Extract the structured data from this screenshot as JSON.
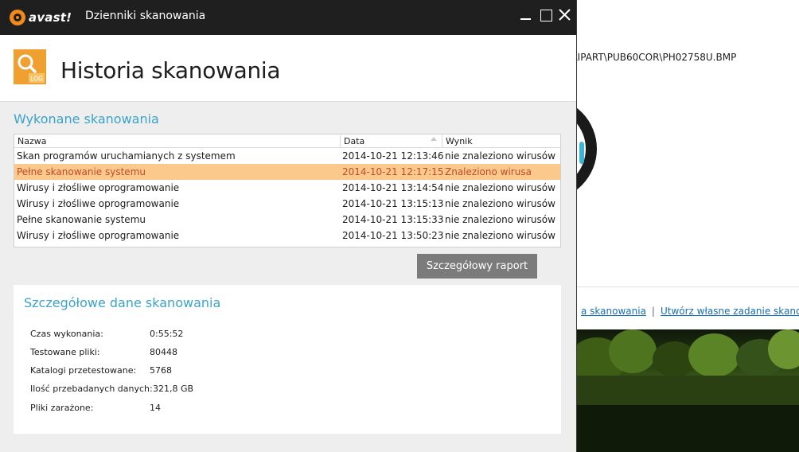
{
  "background": {
    "path_text": "LIPART\\PUB60COR\\PH02758U.BMP",
    "links": [
      {
        "label": "a skanowania"
      },
      {
        "label": "Utwórz własne zadanie skanowania"
      }
    ],
    "link_separator": "|"
  },
  "window": {
    "brand": "avast!",
    "title": "Dzienniki skanowania"
  },
  "header": {
    "title": "Historia skanowania",
    "icon": "log-file-icon",
    "icon_label": "LOG"
  },
  "scans": {
    "section_title": "Wykonane skanowania",
    "columns": [
      "Nazwa",
      "Data",
      "Wynik"
    ],
    "rows": [
      {
        "name": "Skan programów uruchamianych z systemem",
        "date": "2014-10-21 12:13:46",
        "result": "nie znaleziono wirusów",
        "selected": false
      },
      {
        "name": "Pełne skanowanie systemu",
        "date": "2014-10-21 12:17:15",
        "result": "Znaleziono wirusa",
        "selected": true
      },
      {
        "name": "Wirusy i złośliwe oprogramowanie",
        "date": "2014-10-21 13:14:54",
        "result": "nie znaleziono wirusów",
        "selected": false
      },
      {
        "name": "Wirusy i złośliwe oprogramowanie",
        "date": "2014-10-21 13:15:13",
        "result": "nie znaleziono wirusów",
        "selected": false
      },
      {
        "name": "Pełne skanowanie systemu",
        "date": "2014-10-21 13:15:33",
        "result": "nie znaleziono wirusów",
        "selected": false
      },
      {
        "name": "Wirusy i złośliwe oprogramowanie",
        "date": "2014-10-21 13:50:23",
        "result": "nie znaleziono wirusów",
        "selected": false
      }
    ],
    "report_button": "Szczegółowy raport"
  },
  "details": {
    "section_title": "Szczegółowe dane skanowania",
    "items": [
      {
        "label": "Czas wykonania:",
        "value": "0:55:52"
      },
      {
        "label": "Testowane pliki:",
        "value": "80448"
      },
      {
        "label": "Katalogi przetestowane:",
        "value": "5768"
      },
      {
        "label": "Ilość przebadanych danych:",
        "value": "321,8 GB"
      },
      {
        "label": "Pliki zarażone:",
        "value": "14"
      }
    ]
  },
  "colors": {
    "accent": "#3aa3c9",
    "selected_row": "#fcc98d",
    "selected_text": "#c04b2a",
    "brand_orange": "#f08a1c",
    "titlebar": "#1f1f1f"
  }
}
